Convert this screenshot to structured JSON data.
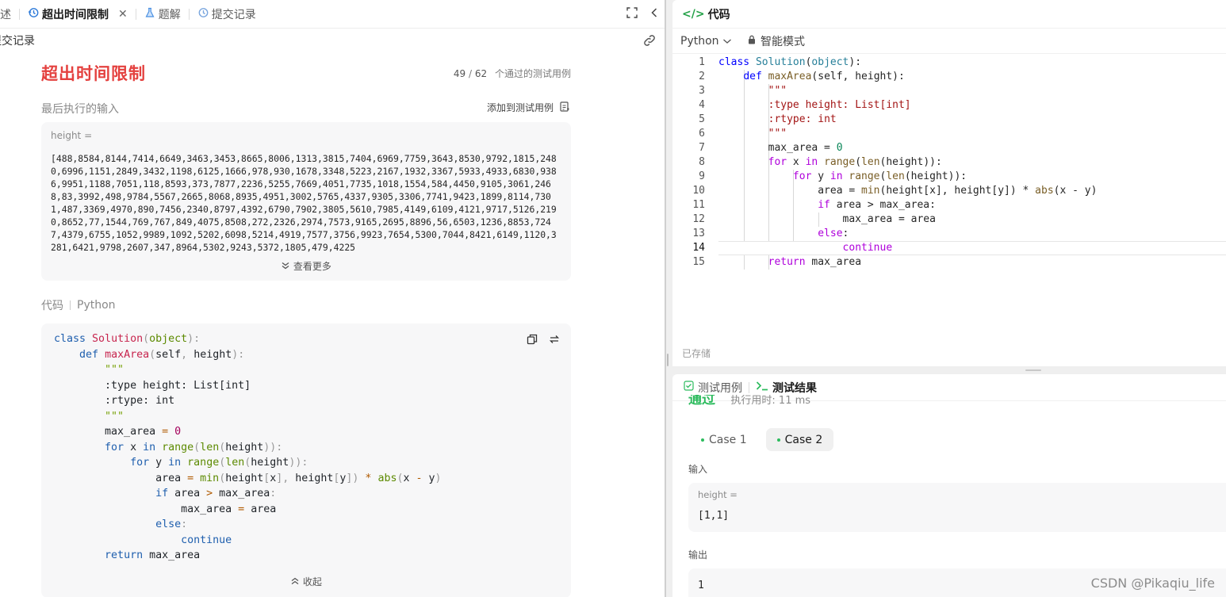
{
  "left": {
    "tabs": [
      {
        "label": "描述",
        "active": false
      },
      {
        "label": "超出时间限制",
        "active": true
      },
      {
        "label": "题解",
        "active": false
      },
      {
        "label": "提交记录",
        "active": false
      }
    ],
    "sub_header": "提交记录",
    "result_title": "超出时间限制",
    "passed": "49",
    "total": "62",
    "passed_suffix": "个通过的测试用例",
    "last_input_title": "最后执行的输入",
    "add_to_testcase": "添加到测试用例",
    "input_var": "height =",
    "input_value": "[488,8584,8144,7414,6649,3463,3453,8665,8006,1313,3815,7404,6969,7759,3643,8530,9792,1815,2480,6996,1151,2849,3432,1198,6125,1666,978,930,1678,3348,5223,2167,1932,3367,5933,4933,6830,9386,9951,1188,7051,118,8593,373,7877,2236,5255,7669,4051,7735,1018,1554,584,4450,9105,3061,2468,83,3992,498,9784,5567,2665,8068,8935,4951,3002,5765,4337,9305,3306,7741,9423,1899,8114,7301,487,3369,4970,890,7456,2340,8797,4392,6790,7902,3805,5610,7985,4149,6109,4121,9717,5126,2190,8652,77,1544,769,767,849,4075,8508,272,2326,2974,7573,9165,2695,8896,56,6503,1236,8853,7247,4379,6755,1052,9989,1092,5202,6098,5214,4919,7577,3756,9923,7654,5300,7044,8421,6149,1120,3281,6421,9798,2607,347,8964,5302,9243,5372,1805,479,4225",
    "see_more": "查看更多",
    "code_label": "代码",
    "code_lang": "Python",
    "collapse": "收起"
  },
  "editor": {
    "title": "代码",
    "language": "Python",
    "mode": "智能模式",
    "saved": "已存储",
    "current_line": 14
  },
  "results": {
    "tab_testcase": "测试用例",
    "tab_result": "测试结果",
    "status": "通过",
    "runtime": "执行用时: 11 ms",
    "cases": [
      {
        "label": "Case 1",
        "active": false
      },
      {
        "label": "Case 2",
        "active": true
      }
    ],
    "input_label": "输入",
    "input_var": "height =",
    "input_value": "[1,1]",
    "output_label": "输出",
    "output_value": "1"
  },
  "watermark": "CSDN @Pikaqiu_life",
  "colors": {
    "tle_red": "#e4413f",
    "pass_green": "#2cbb5d",
    "code_icon_green": "#24a148"
  }
}
